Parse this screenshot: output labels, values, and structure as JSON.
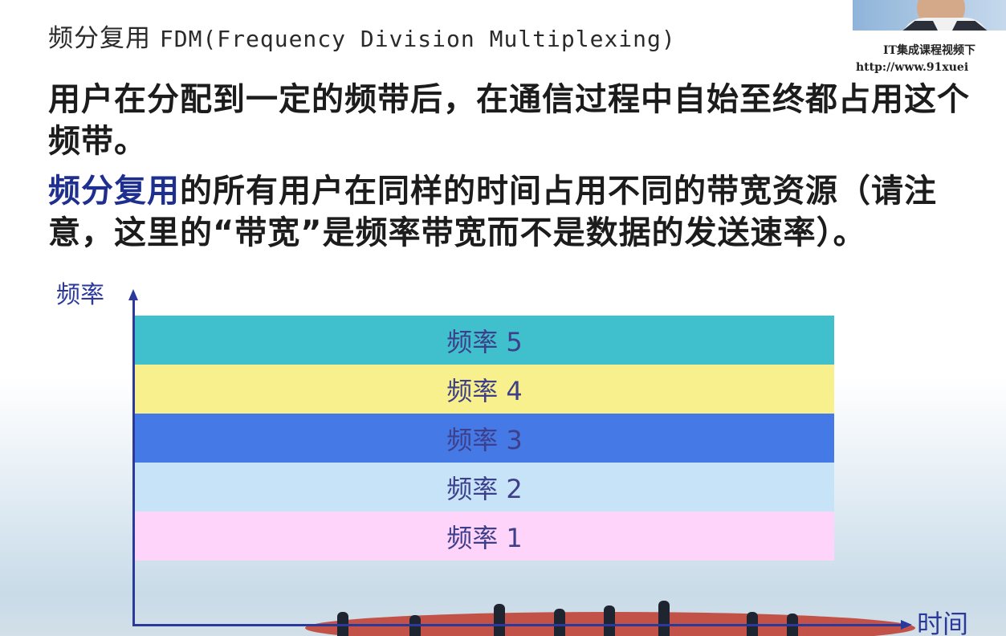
{
  "title": {
    "cn": "频分复用",
    "en": "FDM(Frequency Division Multiplexing)"
  },
  "paragraphs": {
    "p1": "用户在分配到一定的频带后，在通信过程中自始至终都占用这个频带。",
    "p2_highlight": "频分复用",
    "p2_rest": "的所有用户在同样的时间占用不同的带宽资源（请注意，这里的“带宽”是频率带宽而不是数据的发送速率）。"
  },
  "watermark": {
    "line1": "IT集成课程视频下",
    "line2": "http://www.91xuei"
  },
  "diagram": {
    "y_axis_label": "频率",
    "x_axis_label": "时间",
    "bands": [
      {
        "label": "频率 5",
        "color": "#40bfcc"
      },
      {
        "label": "频率 4",
        "color": "#f8f08c"
      },
      {
        "label": "频率 3",
        "color": "#4479e6"
      },
      {
        "label": "频率 2",
        "color": "#c6e3f8"
      },
      {
        "label": "频率 1",
        "color": "#ffd4fa"
      }
    ]
  }
}
